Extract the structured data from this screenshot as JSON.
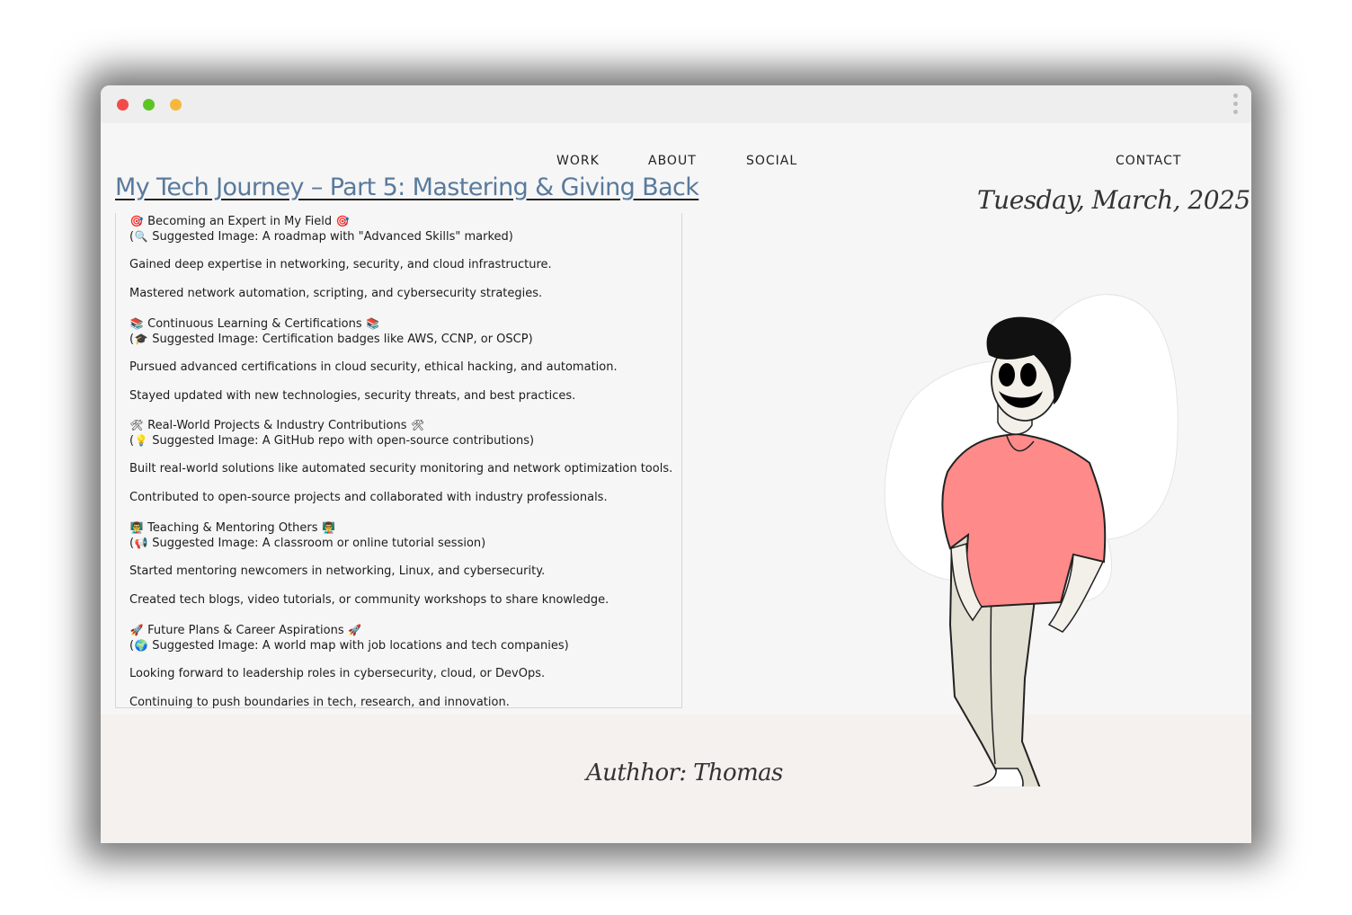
{
  "nav": {
    "work": "WORK",
    "about": "ABOUT",
    "social": "SOCIAL",
    "contact": "CONTACT"
  },
  "post": {
    "title": "My Tech Journey – Part 5: Mastering & Giving Back",
    "date": "Tuesday, March, 2025",
    "author": "Authhor: Thomas"
  },
  "sections": [
    {
      "icon": "🎯",
      "heading": "Becoming an Expert in My Field",
      "image_icon": "🔍",
      "suggested": "Suggested Image: A roadmap with \"Advanced Skills\" marked)",
      "points": [
        "Gained deep expertise in networking, security, and cloud infrastructure.",
        "Mastered network automation, scripting, and cybersecurity strategies."
      ]
    },
    {
      "icon": "📚",
      "heading": "Continuous Learning & Certifications",
      "image_icon": "🎓",
      "suggested": "Suggested Image: Certification badges like AWS, CCNP, or OSCP)",
      "points": [
        "Pursued advanced certifications in cloud security, ethical hacking, and automation.",
        "Stayed updated with new technologies, security threats, and best practices."
      ]
    },
    {
      "icon": "🛠",
      "heading": "Real-World Projects & Industry Contributions",
      "image_icon": "💡",
      "suggested": "Suggested Image: A GitHub repo with open-source contributions)",
      "points": [
        "Built real-world solutions like automated security monitoring and network optimization tools.",
        "Contributed to open-source projects and collaborated with industry professionals."
      ]
    },
    {
      "icon": "👨‍🏫",
      "heading": "Teaching & Mentoring Others",
      "image_icon": "📢",
      "suggested": "Suggested Image: A classroom or online tutorial session)",
      "points": [
        "Started mentoring newcomers in networking, Linux, and cybersecurity.",
        "Created tech blogs, video tutorials, or community workshops to share knowledge."
      ]
    },
    {
      "icon": "🚀",
      "heading": "Future Plans & Career Aspirations",
      "image_icon": "🌍",
      "suggested": "Suggested Image: A world map with job locations and tech companies)",
      "points": [
        "Looking forward to leadership roles in cybersecurity, cloud, or DevOps.",
        "Continuing to push boundaries in tech, research, and innovation."
      ]
    }
  ],
  "colors": {
    "title": "#587a9d",
    "shirt": "#ff8a8a",
    "pants": "#e2dfd3"
  }
}
